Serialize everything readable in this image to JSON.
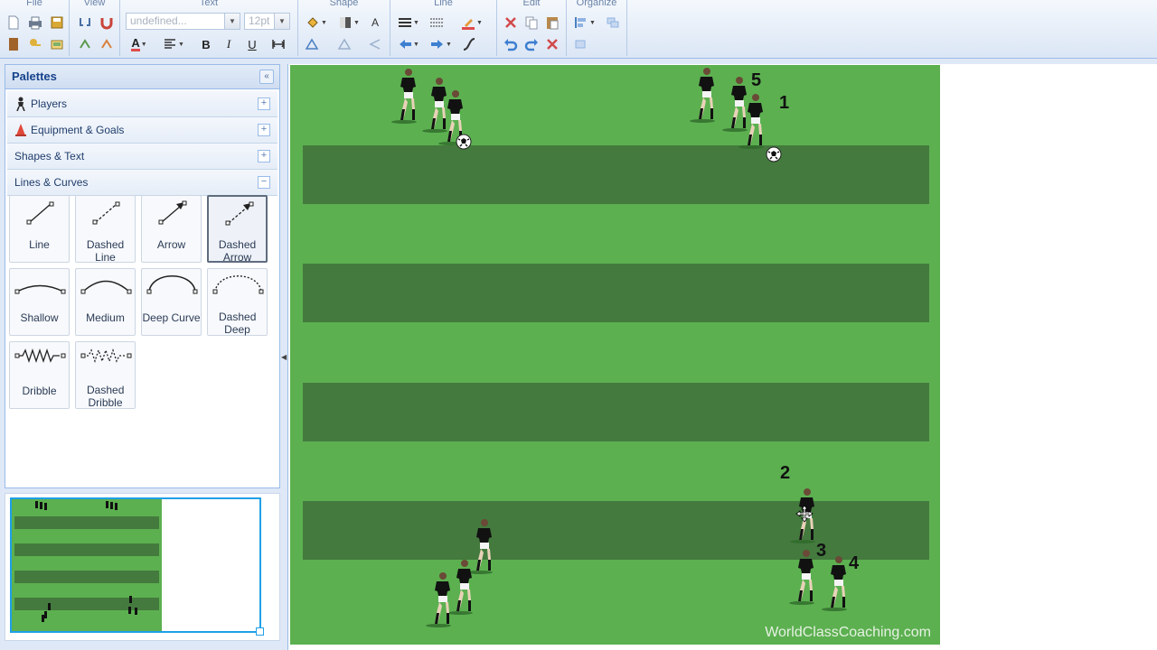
{
  "toolbar": {
    "groups": {
      "file": "File",
      "view": "View",
      "text": "Text",
      "shape": "Shape",
      "line": "Line",
      "edit": "Edit",
      "organize": "Organize"
    },
    "font_family_value": "undefined...",
    "font_size_value": "12pt",
    "icons": [
      "new-icon",
      "print-icon",
      "save-icon",
      "open-icon",
      "key-icon",
      "export-icon",
      "zoom-in-icon",
      "magnet-icon",
      "grid-icon",
      "snap-icon",
      "font-color-icon",
      "align-icon",
      "bold-icon",
      "italic-icon",
      "underline-icon",
      "text-width-icon",
      "fill-icon",
      "gradient-icon",
      "text-style-icon",
      "shadow-icon",
      "line-weight-icon",
      "line-style-icon",
      "line-color-icon",
      "arrow-start-icon",
      "arrow-end-icon",
      "connector-icon",
      "cut-icon",
      "copy-icon",
      "paste-icon",
      "undo-icon",
      "redo-icon",
      "delete-icon",
      "arrange-icon",
      "group-icon",
      "ungroup-icon"
    ],
    "accent_color": "#15428b"
  },
  "sidebar": {
    "title": "Palettes",
    "palettes": [
      {
        "label": "Players",
        "state": "+",
        "icon": "player-icon"
      },
      {
        "label": "Equipment & Goals",
        "state": "+",
        "icon": "cone-icon"
      },
      {
        "label": "Shapes & Text",
        "state": "+",
        "icon": ""
      },
      {
        "label": "Lines & Curves",
        "state": "−",
        "icon": ""
      }
    ],
    "tiles": [
      {
        "label": "Line",
        "icon": "line-icon"
      },
      {
        "label": "Dashed Line",
        "icon": "dashed-line-icon"
      },
      {
        "label": "Arrow",
        "icon": "arrow-icon"
      },
      {
        "label": "Dashed Arrow",
        "icon": "dashed-arrow-icon",
        "selected": true
      },
      {
        "label": "Shallow",
        "icon": "shallow-curve-icon"
      },
      {
        "label": "Medium",
        "icon": "medium-curve-icon"
      },
      {
        "label": "Deep Curve",
        "icon": "deep-curve-icon"
      },
      {
        "label": "Dashed Deep",
        "icon": "dashed-deep-icon"
      },
      {
        "label": "Dribble",
        "icon": "dribble-icon"
      },
      {
        "label": "Dashed Dribble",
        "icon": "dashed-dribble-icon"
      }
    ]
  },
  "canvas": {
    "field_color": "#5cb050",
    "stripe_color": "#447a3e",
    "numbers": [
      "5",
      "1",
      "2",
      "3",
      "4"
    ],
    "watermark": "WorldClassCoaching.com"
  }
}
